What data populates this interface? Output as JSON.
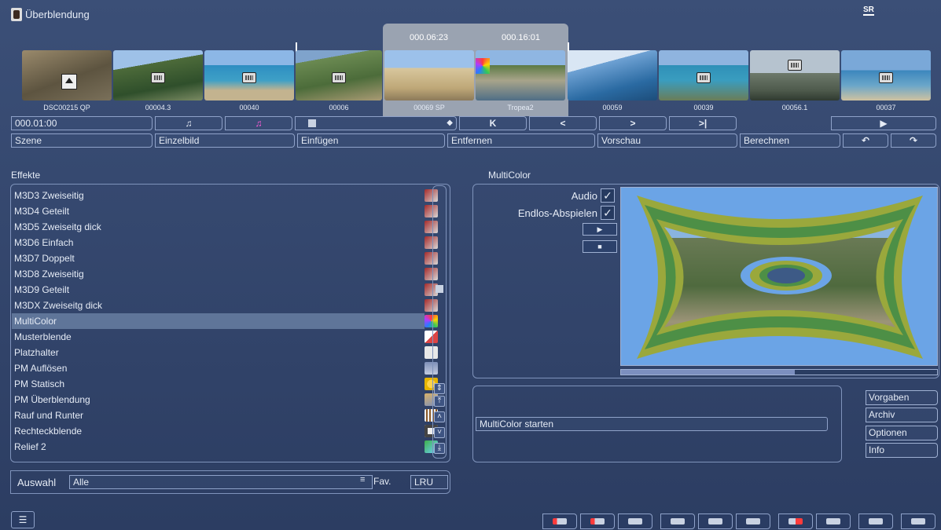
{
  "window": {
    "title": "Überblendung",
    "logo": "SR"
  },
  "timeline": {
    "timecode_in": "000.06:23",
    "timecode_out": "000.16:01",
    "clips": [
      {
        "label": "DSC00215 QP",
        "thumb": "ruins",
        "badge": "up-arrow-icon"
      },
      {
        "label": "00004.3",
        "thumb": "trees",
        "badge": "film-icon"
      },
      {
        "label": "00040",
        "thumb": "coast",
        "badge": "film-icon"
      },
      {
        "label": "00006",
        "thumb": "plants",
        "badge": "film-icon"
      },
      {
        "label": "00069 SP",
        "thumb": "church",
        "badge": ""
      },
      {
        "label": "Tropea2",
        "thumb": "town",
        "badge": ""
      },
      {
        "label": "00059",
        "thumb": "sea",
        "badge": ""
      },
      {
        "label": "00039",
        "thumb": "cliff",
        "badge": "film-icon"
      },
      {
        "label": "00056.1",
        "thumb": "sky",
        "badge": "film-icon"
      },
      {
        "label": "00037",
        "thumb": "beach",
        "badge": "film-icon"
      }
    ]
  },
  "controls": {
    "timecode": "000.01:00",
    "row2": [
      "Szene",
      "Einzelbild",
      "Einfügen",
      "Entfernen",
      "Vorschau",
      "Berechnen"
    ]
  },
  "effects": {
    "heading": "Effekte",
    "items": [
      {
        "label": "M3D3 Zweiseitig",
        "icon": "m3d-icon"
      },
      {
        "label": "M3D4 Geteilt",
        "icon": "m3d-icon"
      },
      {
        "label": "M3D5 Zweiseitg dick",
        "icon": "m3d-icon"
      },
      {
        "label": "M3D6 Einfach",
        "icon": "m3d-icon"
      },
      {
        "label": "M3D7 Doppelt",
        "icon": "m3d-icon"
      },
      {
        "label": "M3D8 Zweiseitig",
        "icon": "m3d-icon"
      },
      {
        "label": "M3D9 Geteilt",
        "icon": "m3d-icon"
      },
      {
        "label": "M3DX Zweiseitg dick",
        "icon": "m3d-icon"
      },
      {
        "label": "MultiColor",
        "icon": "multicolor-icon",
        "selected": true
      },
      {
        "label": "Musterblende",
        "icon": "pattern-icon"
      },
      {
        "label": "Platzhalter",
        "icon": "placeholder-icon"
      },
      {
        "label": "PM Auflösen",
        "icon": "pm-dissolve-icon"
      },
      {
        "label": "PM Statisch",
        "icon": "pm-static-icon"
      },
      {
        "label": "PM Überblendung",
        "icon": "pm-blend-icon"
      },
      {
        "label": "Rauf und Runter",
        "icon": "updown-icon"
      },
      {
        "label": "Rechteckblende",
        "icon": "rectangle-icon"
      },
      {
        "label": "Relief 2",
        "icon": "relief-icon"
      }
    ]
  },
  "selection": {
    "label": "Auswahl",
    "value": "Alle",
    "fav": "Fav.",
    "lru": "LRU"
  },
  "preview": {
    "heading": "MultiColor",
    "audio_label": "Audio",
    "loop_label": "Endlos-Abspielen",
    "audio_checked": true,
    "loop_checked": true
  },
  "status": {
    "text": "MultiColor starten"
  },
  "side_buttons": [
    "Vorgaben",
    "Archiv",
    "Optionen",
    "Info"
  ]
}
